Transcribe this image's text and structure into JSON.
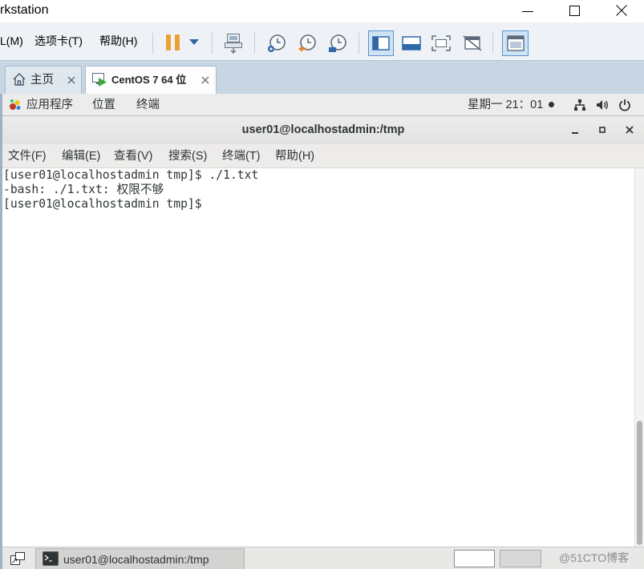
{
  "window": {
    "title": "rkstation"
  },
  "menu": {
    "items": [
      "L(M)",
      "选项卡(T)",
      "帮助(H)"
    ]
  },
  "toolbar": {
    "icons": [
      "pause-icon",
      "dropdown-arrow-icon",
      "send-ctrl-alt-del-icon",
      "snapshot-take-icon",
      "snapshot-revert-icon",
      "snapshot-manager-icon",
      "library-view-icon",
      "thumbnail-bar-icon",
      "fullscreen-icon",
      "unity-icon",
      "console-view-icon"
    ],
    "active_icons": [
      "library-view-icon",
      "console-view-icon"
    ]
  },
  "tabs": [
    {
      "label": "主页",
      "icon": "home-icon",
      "active": false
    },
    {
      "label": "CentOS 7 64 位",
      "icon": "vm-icon",
      "active": true
    }
  ],
  "gnome_panel": {
    "applications": "应用程序",
    "places": "位置",
    "terminal": "终端",
    "clock": "星期一 21：01",
    "status_icons": [
      "network-icon",
      "volume-icon",
      "power-icon"
    ]
  },
  "terminal": {
    "title": "user01@localhostadmin:/tmp",
    "menu": [
      "文件(F)",
      "编辑(E)",
      "查看(V)",
      "搜索(S)",
      "终端(T)",
      "帮助(H)"
    ],
    "lines": [
      "[user01@localhostadmin tmp]$ ./1.txt",
      "-bash: ./1.txt: 权限不够",
      "[user01@localhostadmin tmp]$ "
    ]
  },
  "taskbar": {
    "window_button": "user01@localhostadmin:/tmp",
    "workspaces": [
      {
        "active": true
      },
      {
        "active": false
      }
    ]
  },
  "watermark": "@51CTO博客",
  "colors": {
    "pause": "#eba133",
    "accent": "#2f67a8",
    "run_indicator": "#3aa935",
    "terminal_bg": "#ffffff",
    "terminal_fg": "#2e3436",
    "panel_bg": "#e8e8e7"
  }
}
